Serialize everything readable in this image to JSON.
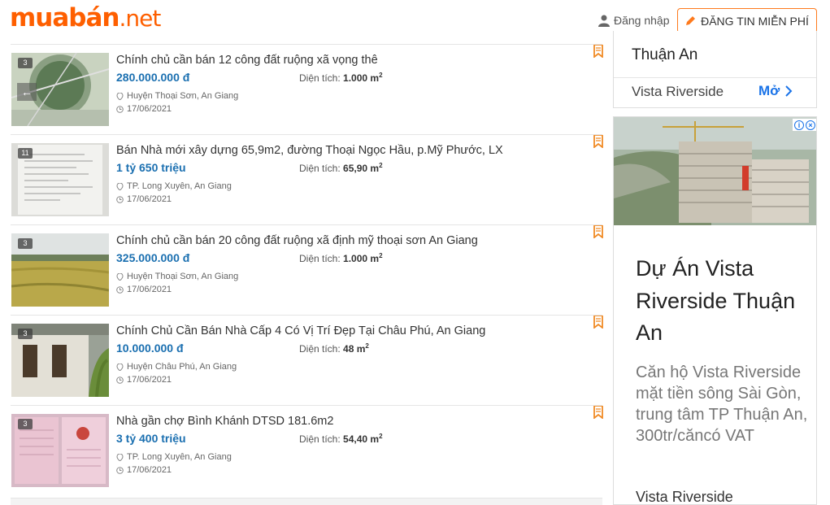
{
  "header": {
    "logo_main": "muabán",
    "logo_tld": ".net",
    "login_label": "Đăng nhập",
    "post_button_label": "ĐĂNG TIN MIỄN PHÍ"
  },
  "listings": [
    {
      "image_count": "3",
      "title": "Chính chủ cần bán 12 công đất ruộng xã vọng thê",
      "price": "280.000.000 đ",
      "area_label": "Diện tích:",
      "area_value": "1.000 m",
      "area_unit_sup": "2",
      "location": "Huyện Thoại Sơn, An Giang",
      "date": "17/06/2021"
    },
    {
      "image_count": "11",
      "title": "Bán Nhà mới xây dựng 65,9m2, đường Thoại Ngọc Hầu, p.Mỹ Phước, LX",
      "price": "1 tỷ 650 triệu",
      "area_label": "Diện tích:",
      "area_value": "65,90 m",
      "area_unit_sup": "2",
      "location": "TP. Long Xuyên, An Giang",
      "date": "17/06/2021"
    },
    {
      "image_count": "3",
      "title": "Chính chủ cần bán 20 công đất ruộng xã định mỹ thoại sơn An Giang",
      "price": "325.000.000 đ",
      "area_label": "Diện tích:",
      "area_value": "1.000 m",
      "area_unit_sup": "2",
      "location": "Huyện Thoại Sơn, An Giang",
      "date": "17/06/2021"
    },
    {
      "image_count": "3",
      "title": "Chính Chủ Cần Bán Nhà Cấp 4 Có Vị Trí Đẹp Tại Châu Phú, An Giang",
      "price": "10.000.000 đ",
      "area_label": "Diện tích:",
      "area_value": "48 m",
      "area_unit_sup": "2",
      "location": "Huyện Châu Phú, An Giang",
      "date": "17/06/2021"
    },
    {
      "image_count": "3",
      "title": "Nhà gần chợ Bình Khánh DTSD 181.6m2",
      "price": "3 tỷ 400 triệu",
      "area_label": "Diện tích:",
      "area_value": "54,40 m",
      "area_unit_sup": "2",
      "location": "TP. Long Xuyên, An Giang",
      "date": "17/06/2021"
    }
  ],
  "sidebar_card": {
    "top_text": "Thuận An",
    "name": "Vista Riverside",
    "open_label": "Mở"
  },
  "ad": {
    "headline": "Dự Án Vista Riverside Thuận An",
    "description": "Căn hộ Vista Riverside mặt tiền sông Sài Gòn, trung tâm TP Thuận An, 300tr/căncó VAT",
    "advertiser": "Vista Riverside"
  },
  "colors": {
    "brand_orange": "#fe5f00",
    "price_blue": "#1a6fb0",
    "link_blue": "#1a73e8"
  }
}
